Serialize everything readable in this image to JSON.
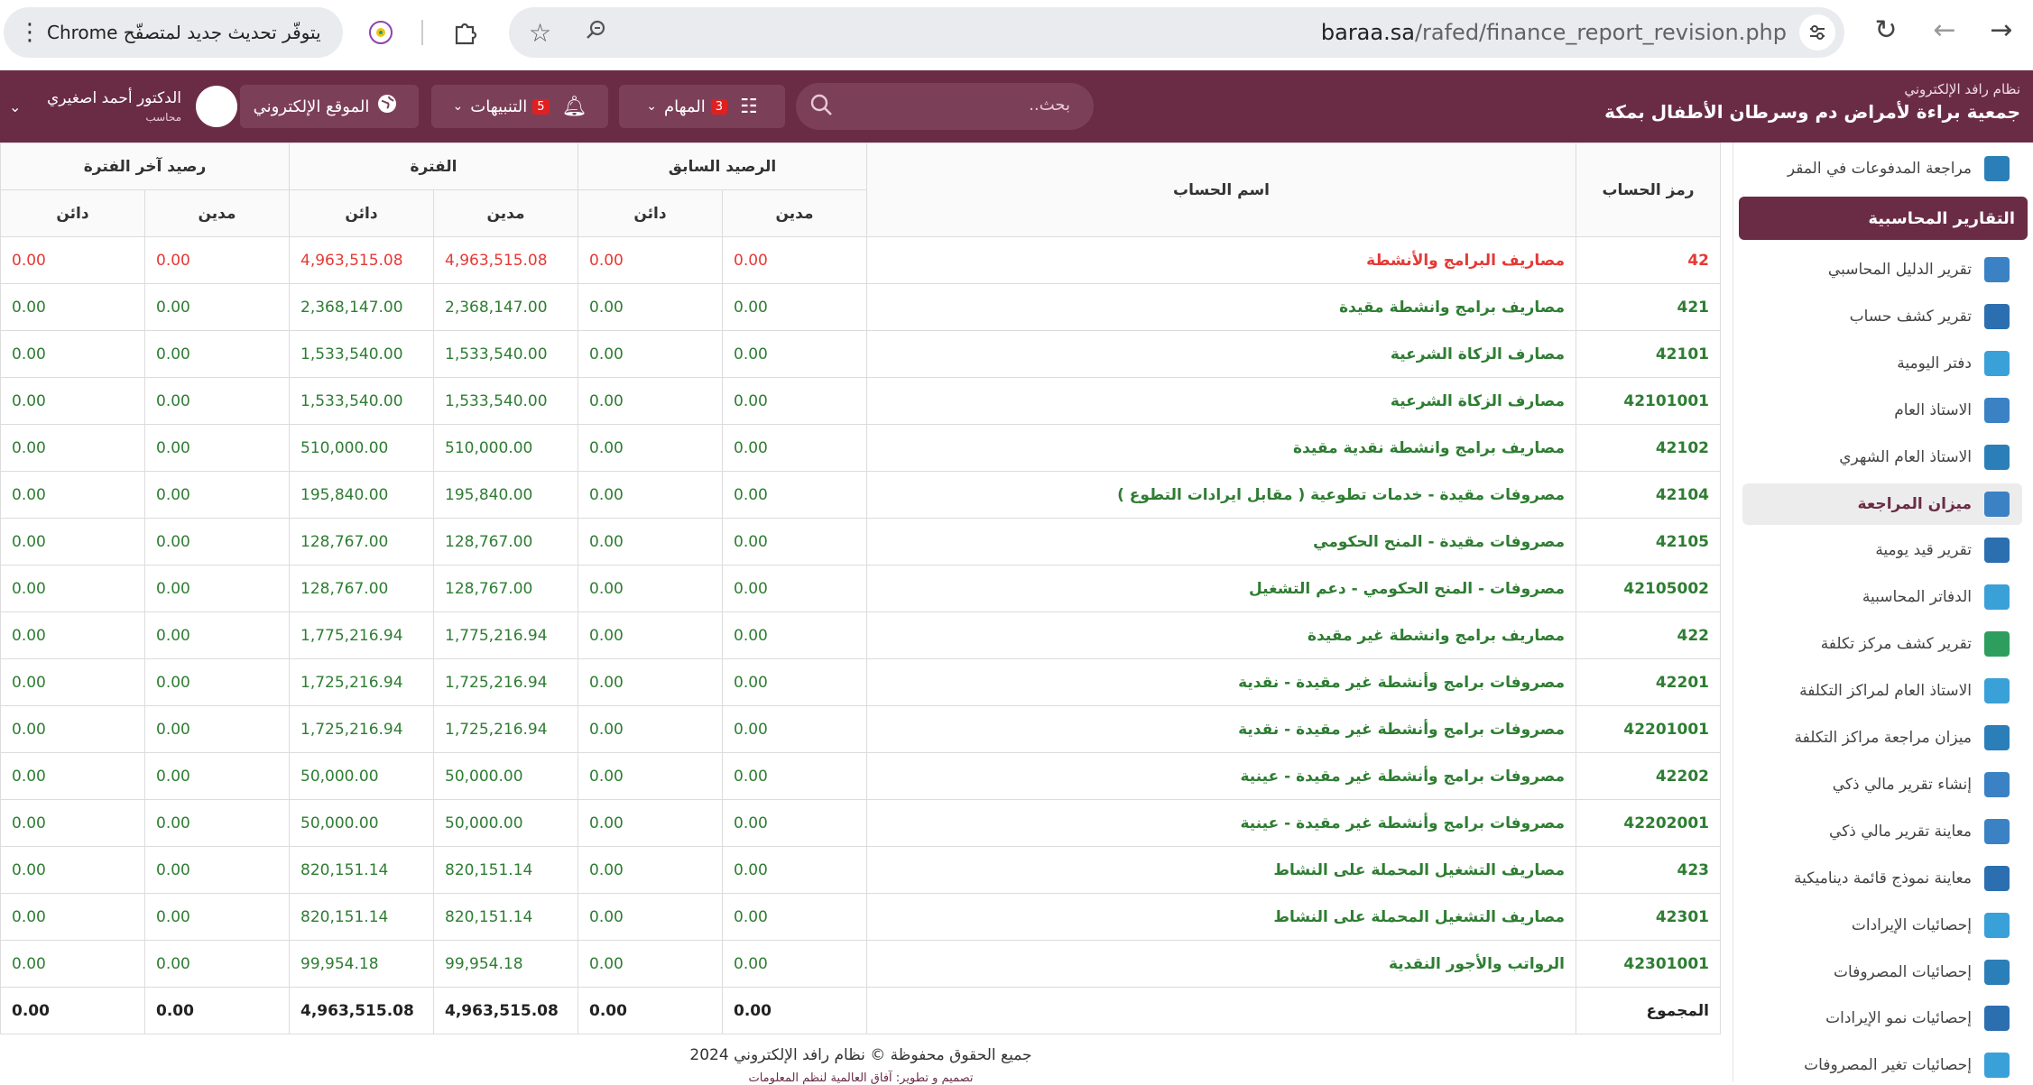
{
  "browser": {
    "update_text": "يتوفّر تحديث جديد لمتصفّح Chrome",
    "url_host": "baraa.sa",
    "url_path": "/rafed/finance_report_revision.php"
  },
  "header": {
    "system_name": "نظام رافد الإلكتروني",
    "org_name": "جمعية براءة لأمراض دم وسرطان الأطفال بمكة",
    "search_placeholder": "بحث..",
    "tasks_label": "المهام",
    "tasks_count": "3",
    "alerts_label": "التنبيهات",
    "alerts_count": "5",
    "website_label": "الموقع الإلكتروني",
    "user_name": "الدكتور أحمد اصغيري",
    "user_role": "محاسب"
  },
  "sidebar": {
    "top_item": "مراجعة المدفوعات في المقر",
    "section_title": "التقارير المحاسبية",
    "items": [
      {
        "label": "تقرير الدليل المحاسبي"
      },
      {
        "label": "تقرير كشف حساب"
      },
      {
        "label": "دفتر اليومية"
      },
      {
        "label": "الاستاذ العام"
      },
      {
        "label": "الاستاذ العام الشهري"
      },
      {
        "label": "ميزان المراجعة"
      },
      {
        "label": "تقرير قيد يومية"
      },
      {
        "label": "الدفاتر المحاسبية"
      },
      {
        "label": "تقرير كشف مركز تكلفة"
      },
      {
        "label": "الاستاذ العام لمراكز التكلفة"
      },
      {
        "label": "ميزان مراجعة مراكز التكلفة"
      },
      {
        "label": "إنشاء تقرير مالي ذكي"
      },
      {
        "label": "معاينة تقرير مالي ذكي"
      },
      {
        "label": "معاينة نموذج قائمة ديناميكية"
      },
      {
        "label": "إحصائيات الإيرادات"
      },
      {
        "label": "إحصائيات المصروفات"
      },
      {
        "label": "إحصائيات نمو الإيرادات"
      },
      {
        "label": "إحصائيات تغير المصروفات"
      }
    ]
  },
  "table": {
    "headers": {
      "code": "رمز الحساب",
      "name": "اسم الحساب",
      "prev_balance": "الرصيد السابق",
      "period": "الفترة",
      "end_balance": "رصيد آخر الفترة",
      "debit": "مدين",
      "credit": "دائن"
    },
    "rows": [
      {
        "code": "42",
        "name": "مصاريف البرامج والأنشطة",
        "v": [
          "0.00",
          "0.00",
          "4,963,515.08",
          "4,963,515.08",
          "0.00",
          "0.00"
        ],
        "red": true
      },
      {
        "code": "421",
        "name": "مصاريف برامج وانشطة مقيدة",
        "v": [
          "0.00",
          "0.00",
          "2,368,147.00",
          "2,368,147.00",
          "0.00",
          "0.00"
        ]
      },
      {
        "code": "42101",
        "name": "مصارف الزكاة الشرعية",
        "v": [
          "0.00",
          "0.00",
          "1,533,540.00",
          "1,533,540.00",
          "0.00",
          "0.00"
        ]
      },
      {
        "code": "42101001",
        "name": "مصارف الزكاة الشرعية",
        "v": [
          "0.00",
          "0.00",
          "1,533,540.00",
          "1,533,540.00",
          "0.00",
          "0.00"
        ]
      },
      {
        "code": "42102",
        "name": "مصاريف برامج وانشطة نقدية مقيدة",
        "v": [
          "0.00",
          "0.00",
          "510,000.00",
          "510,000.00",
          "0.00",
          "0.00"
        ]
      },
      {
        "code": "42104",
        "name": "مصروفات مقيدة - خدمات تطوعية ( مقابل ايرادات التطوع )",
        "v": [
          "0.00",
          "0.00",
          "195,840.00",
          "195,840.00",
          "0.00",
          "0.00"
        ]
      },
      {
        "code": "42105",
        "name": "مصروفات مقيدة - المنح الحكومي",
        "v": [
          "0.00",
          "0.00",
          "128,767.00",
          "128,767.00",
          "0.00",
          "0.00"
        ]
      },
      {
        "code": "42105002",
        "name": "مصروفات - المنح الحكومي - دعم التشغيل",
        "v": [
          "0.00",
          "0.00",
          "128,767.00",
          "128,767.00",
          "0.00",
          "0.00"
        ]
      },
      {
        "code": "422",
        "name": "مصاريف برامج وانشطة غير مقيدة",
        "v": [
          "0.00",
          "0.00",
          "1,775,216.94",
          "1,775,216.94",
          "0.00",
          "0.00"
        ]
      },
      {
        "code": "42201",
        "name": "مصروفات برامج وأنشطة غير مقيدة - نقدية",
        "v": [
          "0.00",
          "0.00",
          "1,725,216.94",
          "1,725,216.94",
          "0.00",
          "0.00"
        ]
      },
      {
        "code": "42201001",
        "name": "مصروفات برامج وأنشطة غير مقيدة - نقدية",
        "v": [
          "0.00",
          "0.00",
          "1,725,216.94",
          "1,725,216.94",
          "0.00",
          "0.00"
        ]
      },
      {
        "code": "42202",
        "name": "مصروفات برامج وأنشطة غير مقيدة - عينية",
        "v": [
          "0.00",
          "0.00",
          "50,000.00",
          "50,000.00",
          "0.00",
          "0.00"
        ]
      },
      {
        "code": "42202001",
        "name": "مصروفات برامج وأنشطة غير مقيدة - عينية",
        "v": [
          "0.00",
          "0.00",
          "50,000.00",
          "50,000.00",
          "0.00",
          "0.00"
        ]
      },
      {
        "code": "423",
        "name": "مصاريف التشغيل المحملة على النشاط",
        "v": [
          "0.00",
          "0.00",
          "820,151.14",
          "820,151.14",
          "0.00",
          "0.00"
        ]
      },
      {
        "code": "42301",
        "name": "مصاريف التشغيل المحملة على النشاط",
        "v": [
          "0.00",
          "0.00",
          "820,151.14",
          "820,151.14",
          "0.00",
          "0.00"
        ]
      },
      {
        "code": "42301001",
        "name": "الرواتب والأجور النقدية",
        "v": [
          "0.00",
          "0.00",
          "99,954.18",
          "99,954.18",
          "0.00",
          "0.00"
        ]
      }
    ],
    "total": {
      "label": "المجموع",
      "v": [
        "0.00",
        "0.00",
        "4,963,515.08",
        "4,963,515.08",
        "0.00",
        "0.00"
      ]
    }
  },
  "footer": {
    "copyright": "جميع الحقوق محفوظة © نظام رافد الإلكتروني 2024",
    "credit": "تصميم و تطوير: آفاق العالمية لنظم المعلومات"
  },
  "colors": {
    "brand": "#6a2c45",
    "positive": "#2e7d32",
    "negative": "#e53935"
  }
}
